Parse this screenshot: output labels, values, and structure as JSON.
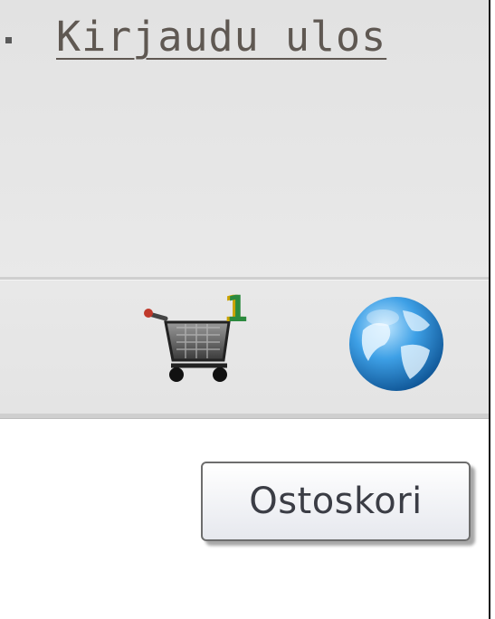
{
  "header": {
    "logout_label": "Kirjaudu ulos"
  },
  "toolbar": {
    "cart_count": "1",
    "cart_icon": "shopping-cart-icon",
    "globe_icon": "globe-icon"
  },
  "tooltip": {
    "text": "Ostoskori"
  },
  "colors": {
    "header_bg": "#e4e4e4",
    "link_color": "#5f5852",
    "cart_count_color": "#2b8a3e",
    "globe_blue": "#1d7fc9"
  }
}
